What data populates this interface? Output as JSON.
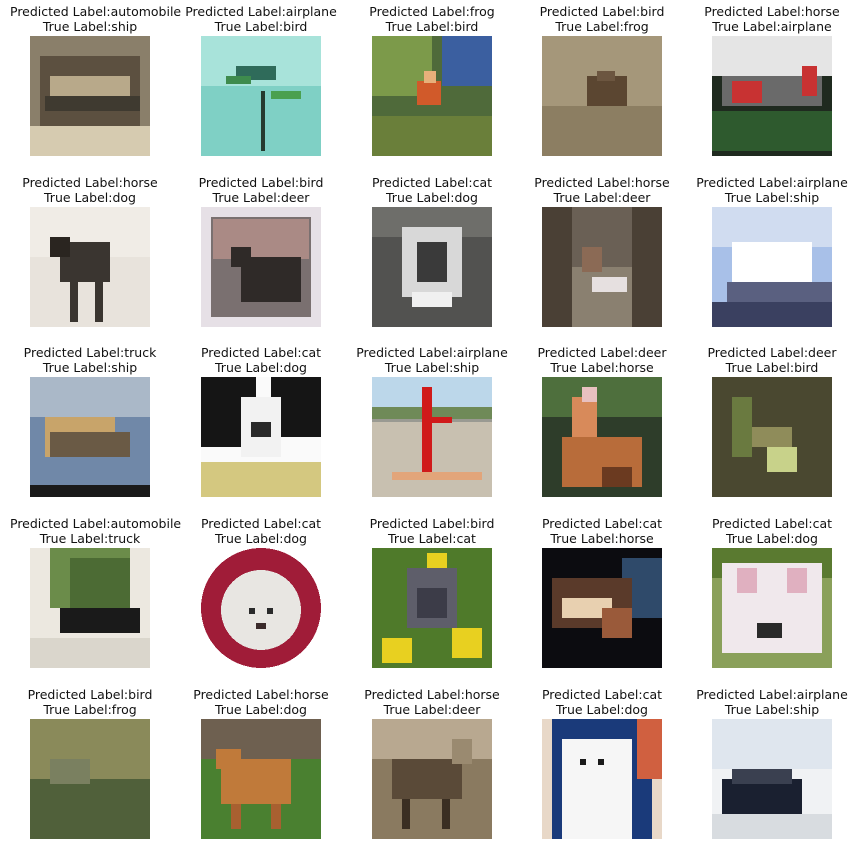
{
  "grid": {
    "rows": 5,
    "cols": 5,
    "items": [
      {
        "predicted": "Predicted Label:automobile",
        "true": "True Label:ship",
        "subject": "boat-photo"
      },
      {
        "predicted": "Predicted Label:airplane",
        "true": "True Label:bird",
        "subject": "hummingbird-photo"
      },
      {
        "predicted": "Predicted Label:frog",
        "true": "True Label:bird",
        "subject": "bird-in-tree-photo"
      },
      {
        "predicted": "Predicted Label:bird",
        "true": "True Label:frog",
        "subject": "frog-on-ground-photo"
      },
      {
        "predicted": "Predicted Label:horse",
        "true": "True Label:airplane",
        "subject": "small-plane-photo"
      },
      {
        "predicted": "Predicted Label:horse",
        "true": "True Label:dog",
        "subject": "dog-standing-photo"
      },
      {
        "predicted": "Predicted Label:bird",
        "true": "True Label:deer",
        "subject": "moose-painting-photo"
      },
      {
        "predicted": "Predicted Label:cat",
        "true": "True Label:dog",
        "subject": "husky-photo"
      },
      {
        "predicted": "Predicted Label:horse",
        "true": "True Label:deer",
        "subject": "deer-in-woods-photo"
      },
      {
        "predicted": "Predicted Label:airplane",
        "true": "True Label:ship",
        "subject": "ferry-photo"
      },
      {
        "predicted": "Predicted Label:truck",
        "true": "True Label:ship",
        "subject": "boat-painting-photo"
      },
      {
        "predicted": "Predicted Label:cat",
        "true": "True Label:dog",
        "subject": "black-white-dog-photo"
      },
      {
        "predicted": "Predicted Label:airplane",
        "true": "True Label:ship",
        "subject": "red-ship-bow-photo"
      },
      {
        "predicted": "Predicted Label:deer",
        "true": "True Label:horse",
        "subject": "rider-on-horse-photo"
      },
      {
        "predicted": "Predicted Label:deer",
        "true": "True Label:bird",
        "subject": "bird-on-branch-photo"
      },
      {
        "predicted": "Predicted Label:automobile",
        "true": "True Label:truck",
        "subject": "pickup-truck-photo"
      },
      {
        "predicted": "Predicted Label:cat",
        "true": "True Label:dog",
        "subject": "white-dog-round-photo"
      },
      {
        "predicted": "Predicted Label:bird",
        "true": "True Label:cat",
        "subject": "cat-in-flowers-photo"
      },
      {
        "predicted": "Predicted Label:cat",
        "true": "True Label:horse",
        "subject": "horse-head-photo"
      },
      {
        "predicted": "Predicted Label:cat",
        "true": "True Label:dog",
        "subject": "white-puppy-photo"
      },
      {
        "predicted": "Predicted Label:bird",
        "true": "True Label:frog",
        "subject": "frog-in-water-photo"
      },
      {
        "predicted": "Predicted Label:horse",
        "true": "True Label:dog",
        "subject": "brown-dog-grass-photo"
      },
      {
        "predicted": "Predicted Label:horse",
        "true": "True Label:deer",
        "subject": "deer-brush-photo"
      },
      {
        "predicted": "Predicted Label:cat",
        "true": "True Label:dog",
        "subject": "white-fluffy-dog-photo"
      },
      {
        "predicted": "Predicted Label:airplane",
        "true": "True Label:ship",
        "subject": "cruise-ship-photo"
      }
    ]
  }
}
